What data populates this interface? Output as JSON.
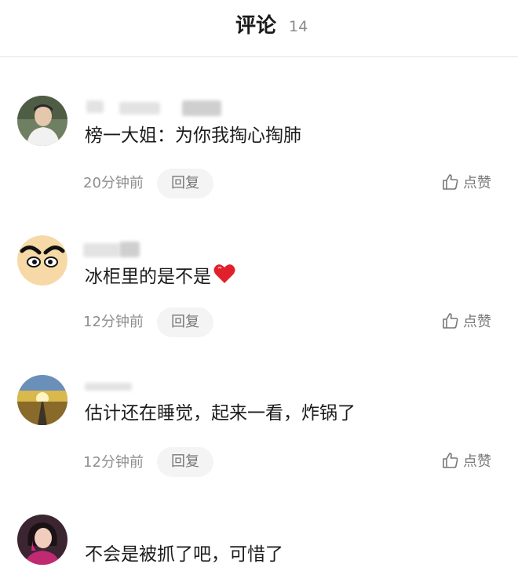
{
  "header": {
    "title": "评论",
    "count": "14"
  },
  "comments": [
    {
      "text": "榜一大姐：为你我掏心掏肺",
      "time": "20分钟前",
      "reply_label": "回复",
      "like_label": "点赞",
      "avatar": "person-photo"
    },
    {
      "text": "冰柜里的是不是",
      "emoji": "heart-emoji",
      "time": "12分钟前",
      "reply_label": "回复",
      "like_label": "点赞",
      "avatar": "cartoon-face"
    },
    {
      "text": "估计还在睡觉，起来一看，炸锅了",
      "time": "12分钟前",
      "reply_label": "回复",
      "like_label": "点赞",
      "avatar": "sunset-road"
    },
    {
      "text": "不会是被抓了吧，可惜了",
      "avatar": "woman-photo"
    }
  ],
  "colors": {
    "like_icon": "#777777",
    "heart": "#e0202a"
  }
}
